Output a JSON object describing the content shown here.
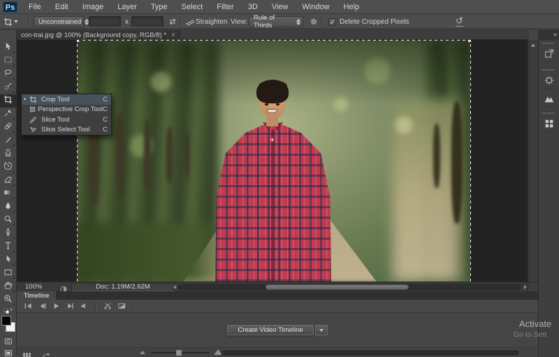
{
  "menubar": {
    "logo": "Ps",
    "items": [
      "File",
      "Edit",
      "Image",
      "Layer",
      "Type",
      "Select",
      "Filter",
      "3D",
      "View",
      "Window",
      "Help"
    ]
  },
  "options_bar": {
    "tool_preset_icon": "crop-icon",
    "aspect_select_value": "Unconstrained",
    "width_value": "",
    "x_label": "x",
    "height_value": "",
    "swap_icon": "swap-values-icon",
    "straighten_icon": "straighten-level-icon",
    "straighten_label": "Straighten",
    "view_label": "View:",
    "view_select_value": "Rule of Thirds",
    "gear_icon": "gear-icon",
    "delete_cropped_checked": "✓",
    "delete_cropped_label": "Delete Cropped Pixels",
    "reset_icon": "↺"
  },
  "document_tab": {
    "title": "con-trai.jpg @ 100% (Background copy, RGB/8) *",
    "close_label": "×"
  },
  "toolbar": {
    "tools": [
      {
        "id": "move-tool"
      },
      {
        "id": "marquee-tool"
      },
      {
        "id": "lasso-tool"
      },
      {
        "id": "quick-selection-tool"
      },
      {
        "id": "crop-tool",
        "active": true
      },
      {
        "id": "eyedropper-tool"
      },
      {
        "id": "spot-healing-tool"
      },
      {
        "id": "brush-tool"
      },
      {
        "id": "clone-stamp-tool"
      },
      {
        "id": "history-brush-tool"
      },
      {
        "id": "eraser-tool"
      },
      {
        "id": "gradient-tool"
      },
      {
        "id": "blur-tool"
      },
      {
        "id": "dodge-tool"
      },
      {
        "id": "pen-tool"
      },
      {
        "id": "type-tool"
      },
      {
        "id": "path-selection-tool"
      },
      {
        "id": "rectangle-tool"
      },
      {
        "id": "hand-tool"
      },
      {
        "id": "zoom-tool"
      }
    ],
    "foreground_color": "#050505",
    "background_color": "#f2f2f2",
    "extras": [
      {
        "id": "quick-mask-button"
      },
      {
        "id": "screen-mode-button"
      }
    ]
  },
  "crop_flyout": {
    "items": [
      {
        "label": "Crop Tool",
        "shortcut": "C",
        "icon": "crop-icon",
        "selected": true
      },
      {
        "label": "Perspective Crop Tool",
        "shortcut": "C",
        "icon": "perspective-crop-icon",
        "selected": false
      },
      {
        "label": "Slice Tool",
        "shortcut": "C",
        "icon": "slice-icon",
        "selected": false
      },
      {
        "label": "Slice Select Tool",
        "shortcut": "C",
        "icon": "slice-select-icon",
        "selected": false
      }
    ]
  },
  "status_bar": {
    "zoom_value": "100%",
    "doc_info": "Doc: 1.19M/2.62M"
  },
  "timeline": {
    "tab_label": "Timeline",
    "transport": [
      {
        "id": "first-frame-button"
      },
      {
        "id": "previous-frame-button"
      },
      {
        "id": "play-button"
      },
      {
        "id": "next-frame-button"
      },
      {
        "id": "audio-mute-button"
      }
    ],
    "tools": [
      {
        "id": "split-clip-button"
      },
      {
        "id": "transition-button"
      }
    ],
    "create_button_label": "Create Video Timeline",
    "frame_view_icon": "frame-view-icon",
    "render_arrow_icon": "curved-arrow-icon"
  },
  "right_dock": {
    "expand_label": "«",
    "panels": [
      {
        "id": "history-panel-button"
      },
      {
        "id": "adjustments-panel-button"
      },
      {
        "id": "histogram-panel-button"
      },
      {
        "id": "color-panel-button"
      }
    ]
  },
  "watermark": {
    "line1": "Activate",
    "line2": "Go to Sett"
  },
  "colors": {
    "flyout_selected": "#46525c",
    "canvas_bg": "#232323",
    "panel_bg": "#474747",
    "shirt_red": "#c23a50"
  }
}
